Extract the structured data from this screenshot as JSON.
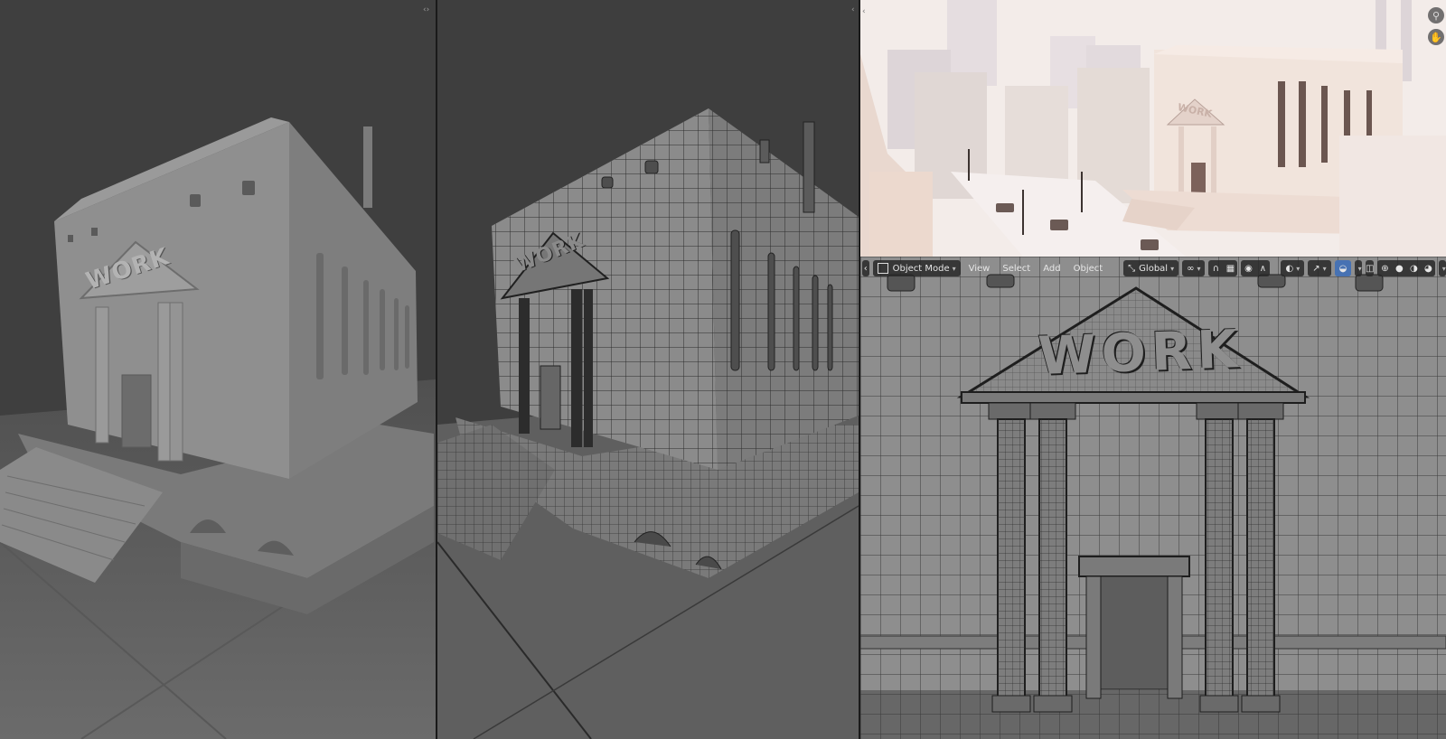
{
  "viewport_header": {
    "mode_label": "Object Mode",
    "menu": [
      "View",
      "Select",
      "Add",
      "Object"
    ],
    "transform_orientation": "Global"
  },
  "sign_text": "WORK",
  "colors": {
    "accent": "#4772b3",
    "viewport_bg": "#3f3f3f",
    "clay": "#8e8e8e",
    "render_bg": "#f1e9e6"
  },
  "icons": {
    "zoom": "magnifier-icon",
    "pan": "hand-icon",
    "mode": "object-mode-icon",
    "orientation": "transform-orientation-icon"
  }
}
